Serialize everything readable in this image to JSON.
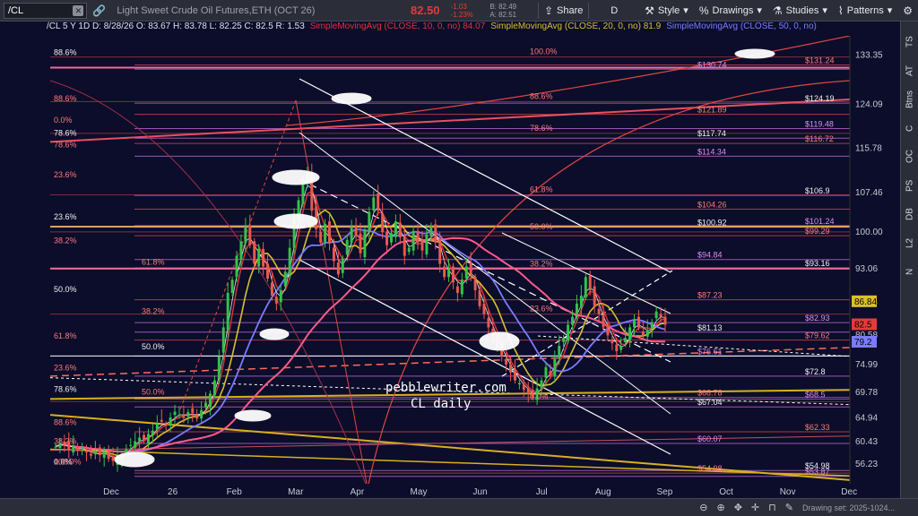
{
  "toolbar": {
    "symbol": "/CL",
    "title": "Light Sweet Crude Oil Futures,ETH (OCT 26)",
    "last": "82.50",
    "change": "-1.03",
    "change_pct": "-1.23%",
    "bid": "B: 82.49",
    "ask": "A: 82.51",
    "share_label": "Share",
    "period_label": "D",
    "style_label": "Style",
    "drawings_label": "Drawings",
    "studies_label": "Studies",
    "patterns_label": "Patterns"
  },
  "study_row": {
    "ohlc": "/CL 5 Y 1D  D: 8/28/26  O: 83.67  H: 83.78  L: 82.25  C: 82.5  R: 1.53",
    "sma10": "SimpleMovingAvg (CLOSE, 10, 0, no) 84.07",
    "sma20": "SimpleMovingAvg (CLOSE, 20, 0, no) 81.9",
    "sma50": "SimpleMovingAvg (CLOSE, 50, 0, no)"
  },
  "right_tabs": [
    "TS",
    "AT",
    "Btns",
    "C",
    "OC",
    "PS",
    "DB",
    "L2",
    "N"
  ],
  "bottom": {
    "drawing_set": "Drawing set: 2025-1024..."
  },
  "watermark": [
    "pebblewriter.com",
    "CL daily"
  ],
  "colors": {
    "background": "#0b0d2a",
    "up_candle": "#35c24a",
    "down_candle": "#e85a4f",
    "sma10": "#e03535",
    "sma20": "#d8c02c",
    "sma50": "#7b7bff",
    "fib_magenta": "#c86ee0",
    "fib_red": "#e04a4a",
    "channel": "#ffffff",
    "price_axis_bg": "#0b0d2a"
  },
  "chart_data": {
    "type": "candlestick",
    "symbol": "/CL",
    "ylim": [
      52.5,
      137
    ],
    "y_ticks": [
      133.35,
      124.09,
      115.78,
      107.46,
      100,
      93.06,
      86.84,
      80.58,
      74.99,
      69.78,
      64.94,
      60.43,
      56.23
    ],
    "x_ticks": [
      "Dec",
      "26",
      "Feb",
      "Mar",
      "Apr",
      "May",
      "Jun",
      "Jul",
      "Aug",
      "Sep",
      "Oct",
      "Nov",
      "Dec"
    ],
    "price_markers": [
      {
        "value": 86.84,
        "color": "#d8c02c"
      },
      {
        "value": 82.5,
        "color": "#e23b3b"
      },
      {
        "value": 79.2,
        "color": "#7b7bff"
      }
    ],
    "series": [
      {
        "name": "SimpleMovingAvg (CLOSE, 10, 0, no)",
        "value": 84.07
      },
      {
        "name": "SimpleMovingAvg (CLOSE, 20, 0, no)",
        "value": 81.9
      },
      {
        "name": "SimpleMovingAvg (CLOSE, 50, 0, no)",
        "value": 79.2
      }
    ],
    "closes": [
      59.5,
      60.2,
      59.8,
      58.9,
      59.6,
      58.7,
      59.3,
      58.4,
      57.8,
      58.6,
      57.9,
      58.5,
      57.2,
      56.8,
      57.5,
      58.1,
      59.0,
      59.8,
      60.5,
      61.2,
      60.8,
      61.9,
      62.5,
      63.8,
      64.2,
      63.5,
      65.0,
      66.1,
      65.5,
      64.9,
      66.0,
      65.8,
      64.8,
      66.4,
      67.8,
      69.5,
      72.0,
      76.5,
      82.0,
      88.5,
      91.0,
      95.5,
      98.2,
      101.0,
      97.5,
      94.0,
      96.8,
      93.5,
      91.2,
      88.0,
      86.5,
      89.0,
      92.5,
      97.0,
      102.5,
      106.0,
      109.5,
      111.0,
      104.0,
      100.5,
      98.0,
      101.5,
      97.8,
      94.5,
      92.0,
      95.0,
      98.5,
      101.0,
      99.2,
      96.0,
      100.5,
      103.8,
      106.5,
      104.0,
      100.0,
      97.5,
      99.8,
      102.0,
      99.0,
      95.5,
      97.0,
      100.2,
      98.0,
      96.5,
      99.5,
      101.2,
      98.0,
      94.0,
      91.5,
      93.0,
      90.5,
      88.5,
      91.0,
      93.5,
      92.0,
      89.0,
      86.0,
      84.5,
      82.0,
      80.5,
      78.0,
      76.5,
      75.0,
      73.5,
      72.0,
      71.5,
      70.2,
      69.5,
      68.8,
      70.5,
      72.0,
      74.5,
      73.0,
      76.0,
      78.5,
      80.0,
      82.5,
      84.0,
      86.5,
      88.0,
      91.5,
      89.0,
      86.0,
      84.5,
      82.0,
      80.5,
      79.0,
      77.5,
      78.5,
      80.0,
      82.0,
      83.5,
      82.0,
      80.5,
      81.5,
      83.0,
      85.0,
      84.0,
      82.5
    ],
    "fib_levels": [
      {
        "label": "100.0%",
        "value": 133.0
      },
      {
        "label": "88.6%",
        "value": 124.6
      },
      {
        "label": "78.6%",
        "value": 118.6
      },
      {
        "label": "61.8%",
        "value": 107.0
      },
      {
        "label": "50.0%",
        "value": 100.0
      },
      {
        "label": "38.2%",
        "value": 93.0
      },
      {
        "label": "23.6%",
        "value": 84.5
      },
      {
        "label": "0.0%",
        "value": 68.0
      }
    ],
    "labels_left": [
      {
        "text": "88.6%",
        "value": 133.0
      },
      {
        "text": "88.6%",
        "value": 124.3
      },
      {
        "text": "0.0%",
        "value": 120.3
      },
      {
        "text": "78.6%",
        "value": 117.8
      },
      {
        "text": "78.6%",
        "value": 115.6
      },
      {
        "text": "23.6%",
        "value": 110.0
      },
      {
        "text": "23.6%",
        "value": 102.0
      },
      {
        "text": "38.2%",
        "value": 97.5
      },
      {
        "text": "61.8%",
        "value": 93.5
      },
      {
        "text": "50.0%",
        "value": 88.3
      },
      {
        "text": "38.2%",
        "value": 84.2
      },
      {
        "text": "61.8%",
        "value": 79.5
      },
      {
        "text": "50.0%",
        "value": 77.5
      },
      {
        "text": "23.6%",
        "value": 73.5
      },
      {
        "text": "50.0%",
        "value": 69.0
      },
      {
        "text": "78.6%",
        "value": 69.5
      },
      {
        "text": "88.6%",
        "value": 63.2
      },
      {
        "text": "38.2%",
        "value": 59.7
      },
      {
        "text": "0.0%",
        "value": 55.8
      },
      {
        "text": "100.0%",
        "value": 55.8
      }
    ],
    "labels_right": [
      {
        "text": "$131.24",
        "value": 131.5
      },
      {
        "text": "$130.74",
        "value": 130.7
      },
      {
        "text": "$124.19",
        "value": 124.3
      },
      {
        "text": "$121.89",
        "value": 122.2
      },
      {
        "text": "$119.48",
        "value": 119.5
      },
      {
        "text": "$117.74",
        "value": 117.7
      },
      {
        "text": "$116.72",
        "value": 116.7
      },
      {
        "text": "$114.34",
        "value": 114.3
      },
      {
        "text": "$106.9",
        "value": 106.9
      },
      {
        "text": "$104.26",
        "value": 104.3
      },
      {
        "text": "$101.24",
        "value": 101.2
      },
      {
        "text": "$100.92",
        "value": 100.9
      },
      {
        "text": "$99.29",
        "value": 99.3
      },
      {
        "text": "$94.84",
        "value": 94.8
      },
      {
        "text": "$93.16",
        "value": 93.2
      },
      {
        "text": "$87.23",
        "value": 87.2
      },
      {
        "text": "$82.93",
        "value": 82.9
      },
      {
        "text": "$81.13",
        "value": 81.1
      },
      {
        "text": "$79.62",
        "value": 79.6
      },
      {
        "text": "$76.61",
        "value": 76.6
      },
      {
        "text": "$72.8",
        "value": 72.8
      },
      {
        "text": "$68.78",
        "value": 68.8
      },
      {
        "text": "$68.5",
        "value": 68.5
      },
      {
        "text": "$67.04",
        "value": 67.0
      },
      {
        "text": "$62.33",
        "value": 62.3
      },
      {
        "text": "$60.07",
        "value": 60.1
      },
      {
        "text": "$54.98",
        "value": 55.0
      },
      {
        "text": "$54.98",
        "value": 54.5
      },
      {
        "text": "$53.87",
        "value": 53.9
      }
    ]
  }
}
